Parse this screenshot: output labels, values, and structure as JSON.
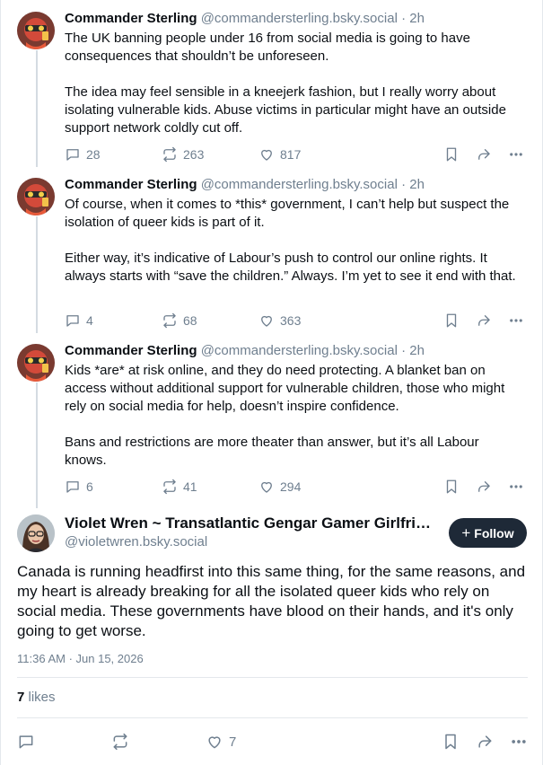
{
  "thread": [
    {
      "author_name": "Commander Sterling",
      "author_handle": "@commandersterling.bsky.social",
      "time": "· 2h",
      "paragraphs": [
        "The UK banning people under 16 from social media is going to have consequences that shouldn’t be unforeseen.",
        "The idea may feel sensible in a kneejerk fashion, but I really worry about isolating vulnerable kids. Abuse victims in particular might have an outside support network coldly cut off."
      ],
      "replies": "28",
      "reposts": "263",
      "likes": "817"
    },
    {
      "author_name": "Commander Sterling",
      "author_handle": "@commandersterling.bsky.social",
      "time": "· 2h",
      "paragraphs": [
        "Of course, when it comes to *this* government, I can’t help but suspect the isolation of queer kids is part of it.",
        "Either way, it’s indicative of Labour’s push to control our online rights. It always starts with “save the children.” Always. I’m yet to see it end with that."
      ],
      "replies": "4",
      "reposts": "68",
      "likes": "363"
    },
    {
      "author_name": "Commander Sterling",
      "author_handle": "@commandersterling.bsky.social",
      "time": "· 2h",
      "paragraphs": [
        "Kids *are* at risk online, and they do need protecting. A blanket ban on access without additional support for vulnerable children, those who might rely on social media for help, doesn’t inspire confidence.",
        "Bans and restrictions are more theater than answer, but it’s all Labour knows."
      ],
      "replies": "6",
      "reposts": "41",
      "likes": "294"
    }
  ],
  "main_post": {
    "author_name": "Violet Wren ~ Transatlantic Gengar Gamer Girlfriend",
    "author_handle": "@violetwren.bsky.social",
    "follow_label": "Follow",
    "text": "Canada is running headfirst into this same thing, for the same reasons, and my heart is already breaking for all the isolated queer kids who rely on social media. These governments have blood on their hands, and it's only going to get worse.",
    "timestamp": "11:36 AM · Jun 15, 2026",
    "like_count": "7",
    "like_word": "likes",
    "action_like_count": "7"
  },
  "icons": [
    "reply-icon",
    "repost-icon",
    "like-icon",
    "bookmark-icon",
    "share-icon",
    "more-icon",
    "plus-icon"
  ],
  "colors": {
    "text": "#0b0f14",
    "muted": "#6f7f8f",
    "follow_bg": "#1e2937",
    "divider": "#e4e8ec"
  }
}
